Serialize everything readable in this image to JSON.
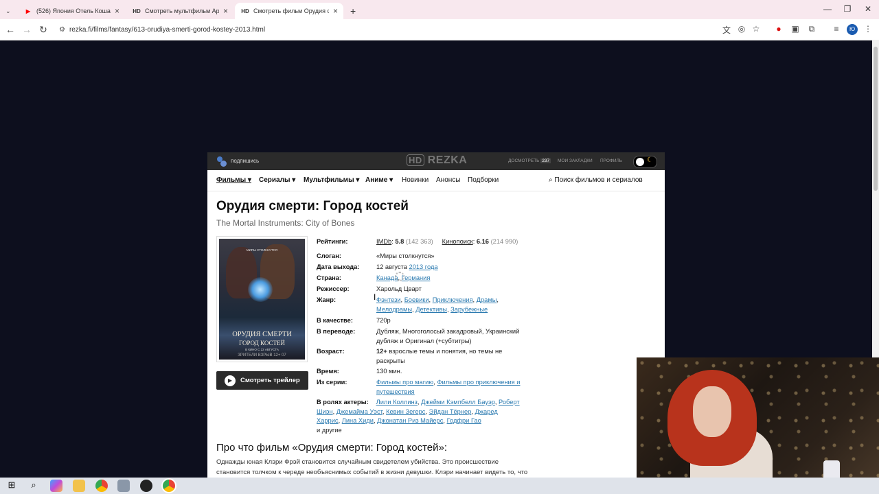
{
  "browser": {
    "tabs": [
      {
        "title": "(526) Япония Отель Кошачий",
        "icon": "youtube-icon",
        "color": "#ff0000",
        "active": false
      },
      {
        "title": "Смотреть мультфильм Аркейн",
        "icon": "hd-icon",
        "color": "#333333",
        "active": false
      },
      {
        "title": "Смотреть фильм Орудия смер",
        "icon": "hd-icon",
        "color": "#333333",
        "active": true
      }
    ],
    "new_tab": "+",
    "url": "rezka.fi/films/fantasy/613-orudiya-smerti-gorod-kostey-2013.html"
  },
  "site": {
    "subscribe": "подпишись",
    "logo_hd": "HD",
    "logo_text": "REZKA",
    "top_links": {
      "watch_later": "ДОСМОТРЕТЬ",
      "watch_later_count": "237",
      "bookmarks": "МОИ ЗАКЛАДКИ",
      "profile": "ПРОФИЛЬ"
    },
    "nav": {
      "films": "Фильмы",
      "series": "Сериалы",
      "cartoons": "Мультфильмы",
      "anime": "Аниме",
      "news": "Новинки",
      "announcements": "Анонсы",
      "collections": "Подборки",
      "search": "Поиск фильмов и сериалов"
    }
  },
  "film": {
    "title": "Орудия смерти: Город костей",
    "original_title": "The Mortal Instruments: City of Bones",
    "poster": {
      "tagline": "МИРЫ СТОЛКНУТСЯ",
      "title_line1": "ОРУДИЯ СМЕРТИ",
      "title_line2": "ГОРОД КОСТЕЙ",
      "release": "В КИНО С 22 АВГУСТА",
      "bottom": "ЗРИТЕЛИ ВЗРЫВ 12+ 07"
    },
    "trailer_button": "Смотреть трейлер",
    "labels": {
      "ratings": "Рейтинги:",
      "slogan": "Слоган:",
      "release": "Дата выхода:",
      "country": "Страна:",
      "director": "Режиссер:",
      "genre": "Жанр:",
      "quality": "В качестве:",
      "translation": "В переводе:",
      "age": "Возраст:",
      "time": "Время:",
      "series": "Из серии:",
      "actors": "В ролях актеры:"
    },
    "ratings": {
      "imdb_label": "IMDb",
      "imdb_value": "5.8",
      "imdb_votes": "(142 363)",
      "kp_label": "Кинопоиск",
      "kp_value": "6.16",
      "kp_votes": "(214 990)"
    },
    "slogan": "«Миры столкнутся»",
    "release_day": "12 августа",
    "release_year": "2013 года",
    "countries": [
      "Канада",
      "Германия"
    ],
    "director": "Харольд Цварт",
    "genres": [
      "Фэнтези",
      "Боевики",
      "Приключения",
      "Драмы",
      "Мелодрамы",
      "Детективы",
      "Зарубежные"
    ],
    "quality": "720p",
    "translation": "Дубляж, Многоголосый закадровый, Украинский дубляж и Оригинал (+субтитры)",
    "age_rating": "12+",
    "age_text": "взрослые темы и понятия, но темы не раскрыты",
    "time": "130 мин.",
    "series": [
      "Фильмы про магию",
      "Фильмы про приключения и путешествия"
    ],
    "actors": [
      "Лили Коллинз",
      "Джейми Кэмпбелл Бауэр",
      "Роберт Шиэн",
      "Джемайма Уэст",
      "Кевин Зегерс",
      "Эйдан Тёрнер",
      "Джаред Харрис",
      "Лина Хиди",
      "Джонатан Риз Майерс",
      "Годфри Гао"
    ],
    "actors_more": "и другие",
    "about_heading": "Про что фильм «Орудия смерти: Город костей»:",
    "about_text": "Однажды юная Клэри Фрэй становится случайным свидетелем убийства. Это происшествие становится толчком к череде необъяснимых событий в жизни девушки. Клэри начинает видеть то, что не"
  }
}
